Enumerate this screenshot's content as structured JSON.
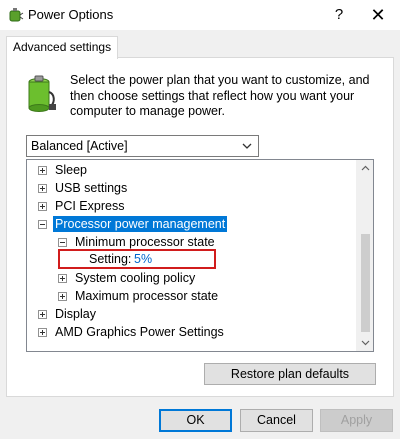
{
  "window": {
    "title": "Power Options",
    "help": "?",
    "close": "✕"
  },
  "tab": {
    "label": "Advanced settings"
  },
  "intro": "Select the power plan that you want to customize, and then choose settings that reflect how you want your computer to manage power.",
  "plan_select": {
    "value": "Balanced [Active]"
  },
  "tree": {
    "items": [
      {
        "label": "Sleep",
        "expander": "plus"
      },
      {
        "label": "USB settings",
        "expander": "plus"
      },
      {
        "label": "PCI Express",
        "expander": "plus"
      },
      {
        "label": "Processor power management",
        "expander": "minus",
        "selected": true
      },
      {
        "label": "Minimum processor state",
        "expander": "minus"
      },
      {
        "label": "System cooling policy",
        "expander": "plus"
      },
      {
        "label": "Maximum processor state",
        "expander": "plus"
      },
      {
        "label": "Display",
        "expander": "plus"
      },
      {
        "label": "AMD Graphics Power Settings",
        "expander": "plus"
      }
    ],
    "setting": {
      "label": "Setting:",
      "value": "5%"
    }
  },
  "buttons": {
    "restore": "Restore plan defaults",
    "ok": "OK",
    "cancel": "Cancel",
    "apply": "Apply"
  },
  "colors": {
    "selection": "#0078d7",
    "highlight_box": "#d11c1c",
    "setting_value": "#0066cc"
  },
  "icons": {
    "app": "power-options-icon",
    "plan": "battery-plug-icon"
  }
}
